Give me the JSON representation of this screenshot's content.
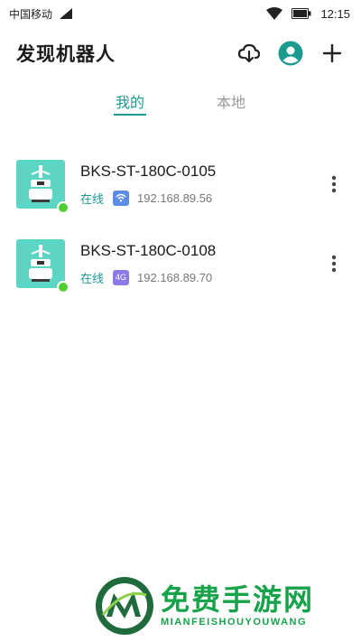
{
  "status_bar": {
    "carrier": "中国移动",
    "time": "12:15"
  },
  "header": {
    "title": "发现机器人",
    "icons": [
      "cloud-download-icon",
      "avatar-icon",
      "plus-icon"
    ]
  },
  "tabs": [
    {
      "label": "我的",
      "active": true
    },
    {
      "label": "本地",
      "active": false
    }
  ],
  "devices": [
    {
      "name": "BKS-ST-180C-0105",
      "status": "在线",
      "network": "wifi",
      "network_label": "",
      "ip": "192.168.89.56"
    },
    {
      "name": "BKS-ST-180C-0108",
      "status": "在线",
      "network": "4g",
      "network_label": "4G",
      "ip": "192.168.89.70"
    }
  ],
  "watermark": {
    "title": "免费手游网",
    "subtitle": "MIANFEISHOUYOUWANG"
  },
  "colors": {
    "accent": "#1b9a8f",
    "online": "#4fcf2f",
    "thumb": "#5dd5c5",
    "wifi_badge": "#5b8de8",
    "fourg_badge": "#8b7be8",
    "watermark": "#17a34a"
  }
}
